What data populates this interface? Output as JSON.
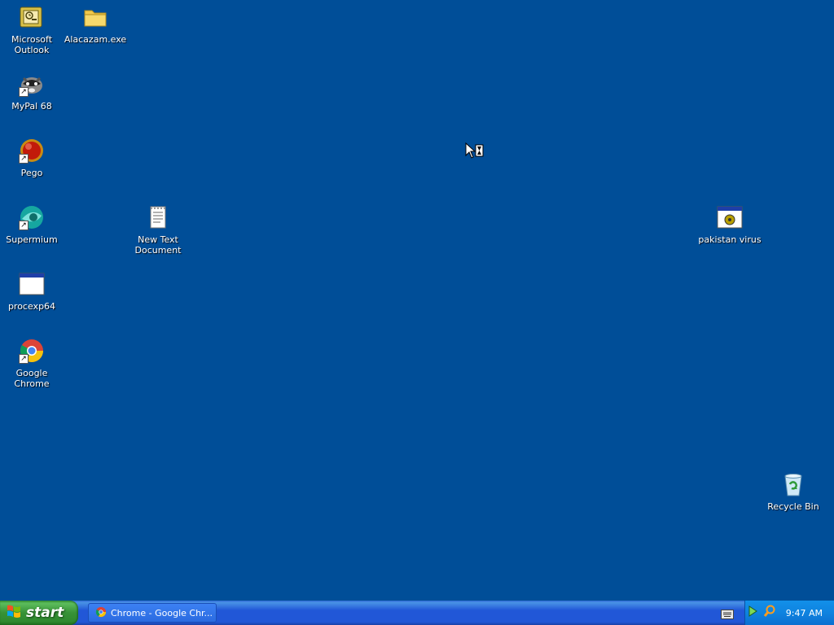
{
  "desktop": {
    "icons": {
      "outlook": "Microsoft Outlook",
      "alacazam": "Alacazam.exe",
      "mypal": "MyPal 68",
      "pego": "Pego",
      "supermium": "Supermium",
      "newtext": "New Text Document",
      "pakistan": "pakistan virus",
      "procexp": "procexp64",
      "chrome": "Google Chrome",
      "recycle": "Recycle Bin"
    }
  },
  "taskbar": {
    "start_label": "start",
    "task_label": "Chrome - Google Chr...",
    "clock": "9:47 AM"
  },
  "colors": {
    "desktop_bg": "#004e98",
    "start_green": "#379237",
    "taskbar_blue": "#2157d7"
  }
}
